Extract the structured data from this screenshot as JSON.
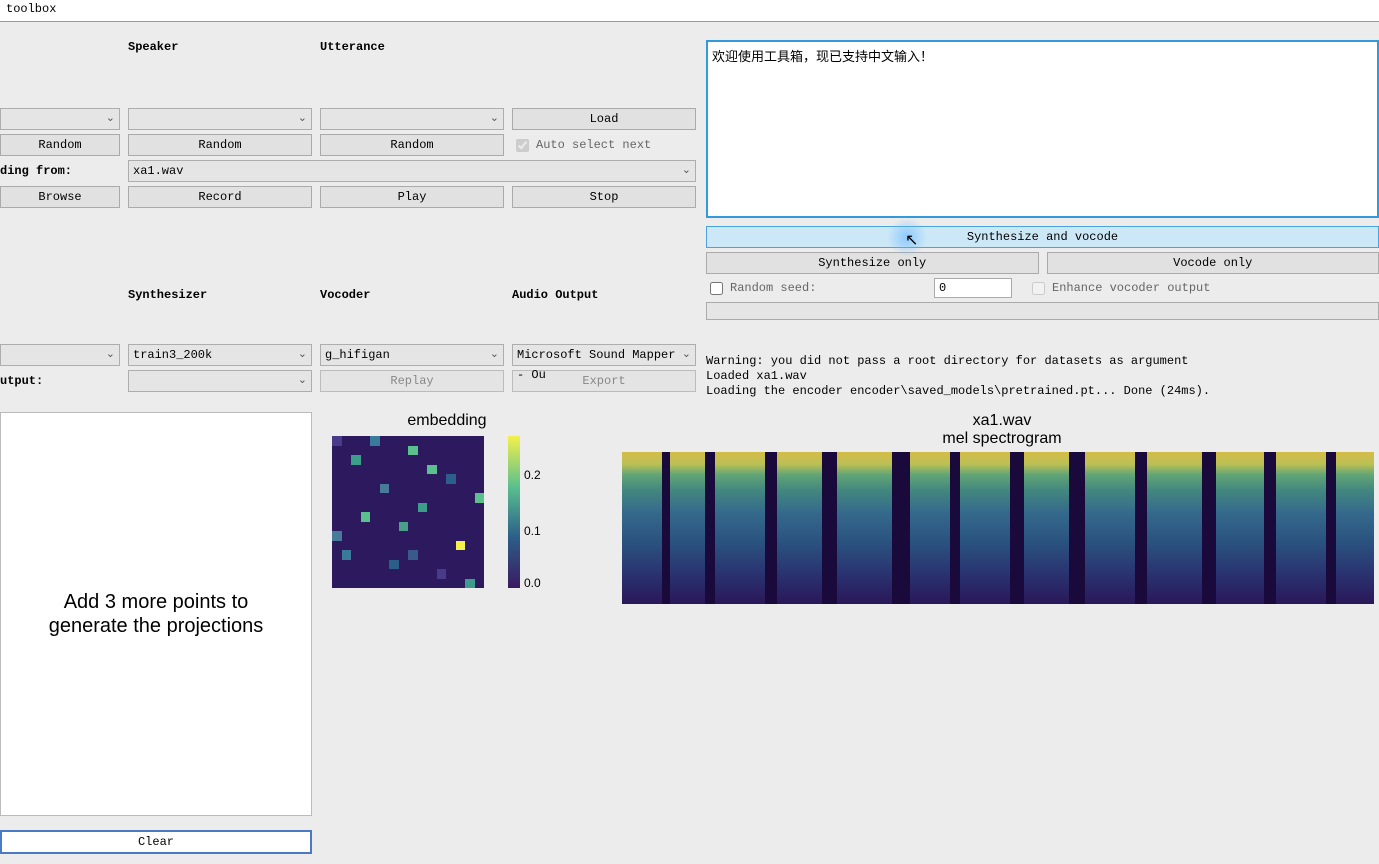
{
  "window": {
    "title": "toolbox"
  },
  "headers": {
    "speaker": "Speaker",
    "utterance": "Utterance",
    "synthesizer": "Synthesizer",
    "vocoder": "Vocoder",
    "audio_output": "Audio Output"
  },
  "labels": {
    "recording_from": "ding from:",
    "output": "utput:",
    "auto_select": "Auto select next",
    "random_seed": "Random seed:",
    "enhance": "Enhance vocoder output"
  },
  "buttons": {
    "load": "Load",
    "random1": "Random",
    "random2": "Random",
    "random3": "Random",
    "browse": "Browse",
    "record": "Record",
    "play": "Play",
    "stop": "Stop",
    "replay": "Replay",
    "export": "Export",
    "synth_vocode": "Synthesize and vocode",
    "synth_only": "Synthesize only",
    "vocode_only": "Vocode only",
    "clear": "Clear"
  },
  "dropdowns": {
    "dataset": "",
    "speaker": "",
    "utterance": "",
    "recording_file": "xa1.wav",
    "encoder": "",
    "synthesizer": "train3_200k",
    "vocoder": "g_hifigan",
    "audio_out": "Microsoft Sound Mapper - Ou",
    "output_file": ""
  },
  "text_input": "欢迎使用工具箱，现已支持中文输入！",
  "seed_value": "0",
  "log": "Warning: you did not pass a root directory for datasets as argument\nLoaded xa1.wav\nLoading the encoder encoder\\saved_models\\pretrained.pt... Done (24ms).",
  "projection_text": "Add 3 more points to\ngenerate the projections",
  "embedding": {
    "title": "embedding",
    "colorbar_ticks": [
      "0.2",
      "0.1",
      "0.0"
    ]
  },
  "spectrogram": {
    "file": "xa1.wav",
    "title": "mel spectrogram"
  }
}
